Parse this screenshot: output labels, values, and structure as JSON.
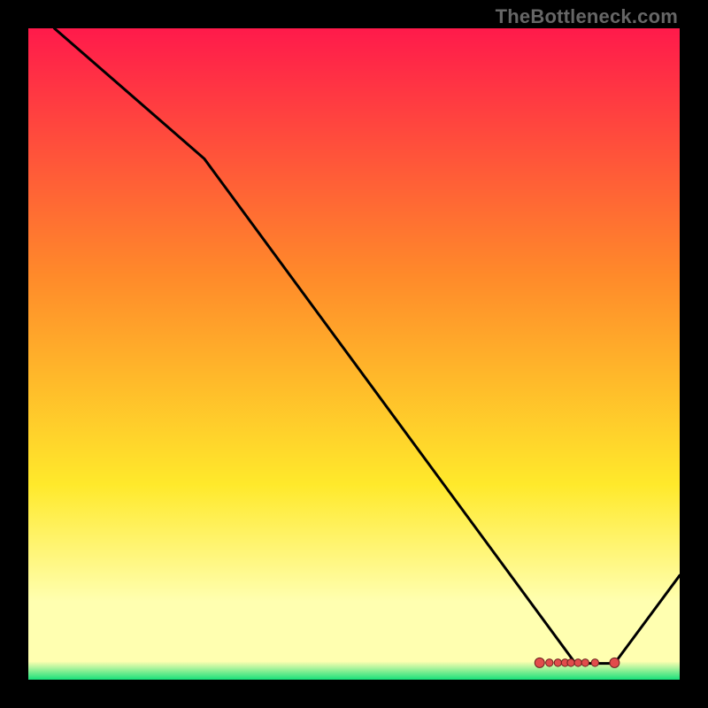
{
  "watermark": "TheBottleneck.com",
  "colors": {
    "gradient_top": "#ff1a4b",
    "gradient_mid_upper": "#ff8a2a",
    "gradient_mid": "#ffe92b",
    "gradient_lower": "#ffffb0",
    "gradient_bottom": "#18e07a",
    "line": "#000000",
    "marker_fill": "#e24c4c",
    "marker_edge": "#6a1f1f",
    "frame": "#000000"
  },
  "chart_data": {
    "type": "line",
    "title": "",
    "xlabel": "",
    "ylabel": "",
    "xlim": [
      0,
      100
    ],
    "ylim": [
      0,
      100
    ],
    "line": {
      "x": [
        4,
        27,
        84,
        90,
        100
      ],
      "y": [
        100,
        80,
        2.5,
        2.5,
        16
      ]
    },
    "markers": {
      "x": [
        78.5,
        80.0,
        81.3,
        82.4,
        83.3,
        84.4,
        85.5,
        87.0,
        90.0
      ],
      "y": [
        2.6,
        2.6,
        2.6,
        2.6,
        2.6,
        2.6,
        2.6,
        2.6,
        2.6
      ]
    },
    "notes": "Axes numeric values are relative (no tick labels shown in source image); y increases upward."
  }
}
